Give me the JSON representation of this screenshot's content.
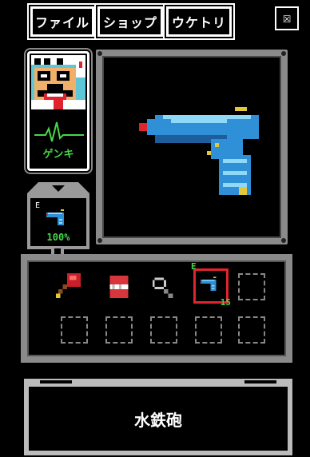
{
  "menu": {
    "file_label": "ファイル",
    "shop_label": "ショップ",
    "receive_label": "ウケトリ",
    "close_glyph": "☒"
  },
  "character": {
    "status": "ゲンキ",
    "status_color": "#46d84a"
  },
  "equipped": {
    "letter": "E",
    "durability": "100%",
    "icon": "water-pistol-icon"
  },
  "weapon": {
    "name": "水鉄砲",
    "icon": "water-pistol-icon",
    "body_color": "#2f90d8",
    "highlight_color": "#8fd8f8",
    "trim_color": "#e0c83a"
  },
  "inventory": {
    "rows": 2,
    "cols": 5,
    "items": [
      {
        "icon": "hammer-icon"
      },
      {
        "icon": "dentures-icon"
      },
      {
        "icon": "magnifier-icon"
      },
      {
        "icon": "water-pistol-icon",
        "selected": true,
        "equipped_letter": "E",
        "count": "15"
      },
      {
        "icon": "empty"
      }
    ],
    "selected_color": "#e0242f"
  }
}
